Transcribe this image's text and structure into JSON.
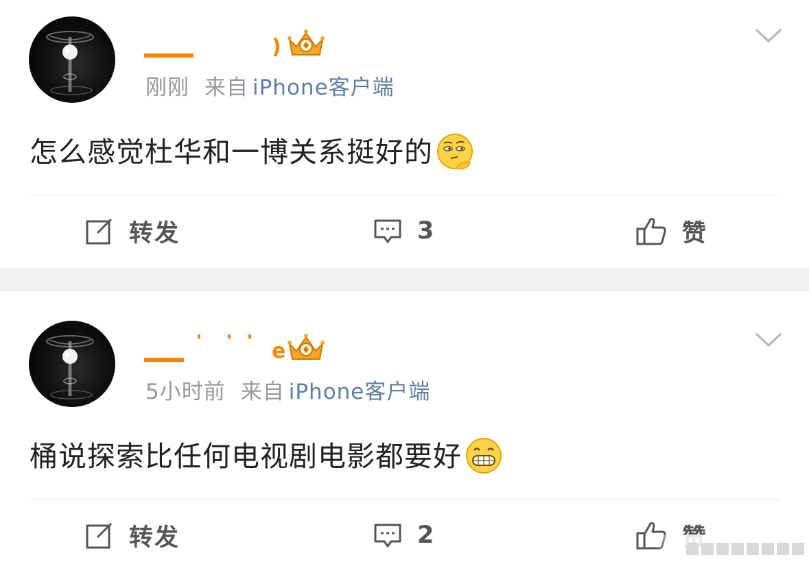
{
  "posts": [
    {
      "time": "刚刚",
      "from_label": "来自",
      "source": "iPhone客户端",
      "content": "怎么感觉杜华和一博关系挺好的",
      "emoji": "thinking-face-emoji",
      "actions": {
        "repost_label": "转发",
        "comment_count": "3",
        "like_label": "赞"
      }
    },
    {
      "time": "5小时前",
      "from_label": "来自",
      "source": "iPhone客户端",
      "content": "桶说探索比任何电视剧电影都要好",
      "emoji": "grinning-face-emoji",
      "actions": {
        "repost_label": "转发",
        "comment_count": "2",
        "like_label": "赞"
      }
    }
  ],
  "icons": {
    "badge": "crown-icon",
    "more": "chevron-down-icon",
    "repost": "edit-icon",
    "comment": "comment-icon",
    "like": "thumbs-up-icon"
  },
  "colors": {
    "username": "#ff8200",
    "source_link": "#5b7fa6",
    "meta": "#999999",
    "text": "#222222",
    "separator": "#f2f2f2"
  }
}
